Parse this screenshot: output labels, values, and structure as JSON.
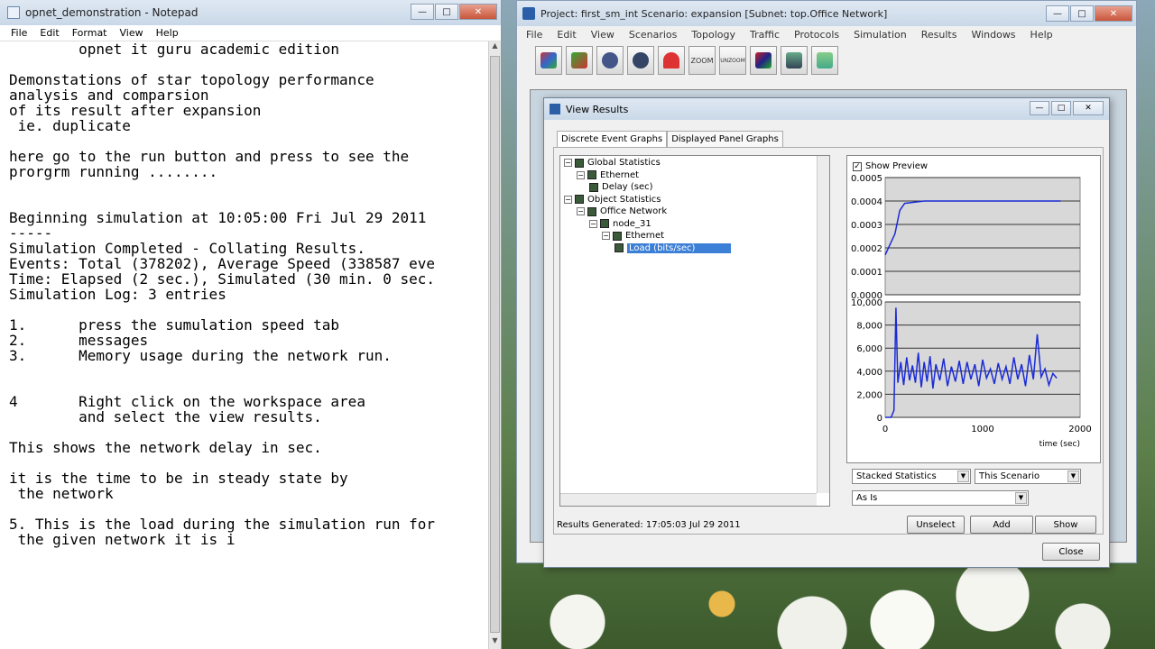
{
  "notepad": {
    "title": "opnet_demonstration - Notepad",
    "menu": [
      "File",
      "Edit",
      "Format",
      "View",
      "Help"
    ],
    "lines": [
      "        opnet it guru academic edition",
      "",
      "Demonstations of star topology performance",
      "analysis and comparsion",
      "of its result after expansion",
      " ie. duplicate",
      "",
      "here go to the run button and press to see the",
      "prorgrm running ........",
      "",
      "",
      "Beginning simulation at 10:05:00 Fri Jul 29 2011",
      "-----",
      "Simulation Completed - Collating Results.",
      "Events: Total (378202), Average Speed (338587 eve",
      "Time: Elapsed (2 sec.), Simulated (30 min. 0 sec.",
      "Simulation Log: 3 entries",
      "",
      "1.      press the sumulation speed tab",
      "2.      messages",
      "3.      Memory usage during the network run.",
      "",
      "",
      "4       Right click on the workspace area",
      "        and select the view results.",
      "",
      "This shows the network delay in sec.",
      "",
      "it is the time to be in steady state by",
      " the network",
      "",
      "5. This is the load during the simulation run for",
      " the given network it is i"
    ]
  },
  "project": {
    "title": "Project: first_sm_int Scenario: expansion  [Subnet: top.Office Network]",
    "menu": [
      "File",
      "Edit",
      "View",
      "Scenarios",
      "Topology",
      "Traffic",
      "Protocols",
      "Simulation",
      "Results",
      "Windows",
      "Help"
    ],
    "toolbar_labels": [
      "ZOOM",
      "UNZOOM"
    ]
  },
  "view_results": {
    "title": "View Results",
    "tabs": [
      "Discrete Event Graphs",
      "Displayed Panel Graphs"
    ],
    "tree": [
      {
        "label": "Global Statistics",
        "level": 0
      },
      {
        "label": "Ethernet",
        "level": 1
      },
      {
        "label": "Delay (sec)",
        "level": 2
      },
      {
        "label": "Object Statistics",
        "level": 0
      },
      {
        "label": "Office Network",
        "level": 1
      },
      {
        "label": "node_31",
        "level": 2
      },
      {
        "label": "Ethernet",
        "level": 3
      },
      {
        "label": "Load (bits/sec)",
        "level": 4,
        "selected": true
      }
    ],
    "show_preview_label": "Show Preview",
    "show_preview_checked": true,
    "stacked_select": "Stacked Statistics",
    "scenario_select": "This Scenario",
    "as_is_select": "As Is",
    "status": "Results Generated: 17:05:03 Jul 29 2011",
    "buttons": {
      "unselect": "Unselect",
      "add": "Add",
      "show": "Show",
      "close": "Close"
    }
  },
  "chart_data": [
    {
      "type": "line",
      "title": "",
      "ylim": [
        0,
        0.0005
      ],
      "yticks": [
        "0.0005",
        "0.0004",
        "0.0003",
        "0.0002",
        "0.0001",
        "0.0000"
      ],
      "xlim": [
        0,
        2000
      ],
      "series": [
        {
          "values": [
            [
              0,
              0.00017
            ],
            [
              100,
              0.00026
            ],
            [
              150,
              0.00036
            ],
            [
              200,
              0.00039
            ],
            [
              400,
              0.0004
            ],
            [
              800,
              0.0004
            ],
            [
              1200,
              0.0004
            ],
            [
              1800,
              0.0004
            ]
          ]
        }
      ]
    },
    {
      "type": "line",
      "ylim": [
        0,
        10000
      ],
      "yticks": [
        "10,000",
        "8,000",
        "6,000",
        "4,000",
        "2,000",
        "0"
      ],
      "xticks": [
        "0",
        "1000",
        "2000"
      ],
      "xlabel": "time (sec)",
      "xlim": [
        0,
        2000
      ],
      "series": [
        {
          "values": [
            [
              0,
              0
            ],
            [
              60,
              0
            ],
            [
              90,
              600
            ],
            [
              110,
              9500
            ],
            [
              130,
              3000
            ],
            [
              160,
              4800
            ],
            [
              190,
              2800
            ],
            [
              220,
              5200
            ],
            [
              250,
              3200
            ],
            [
              280,
              4500
            ],
            [
              310,
              3000
            ],
            [
              340,
              5600
            ],
            [
              370,
              2600
            ],
            [
              400,
              4800
            ],
            [
              430,
              3100
            ],
            [
              460,
              5300
            ],
            [
              490,
              2500
            ],
            [
              520,
              4600
            ],
            [
              560,
              3200
            ],
            [
              600,
              5100
            ],
            [
              640,
              2700
            ],
            [
              680,
              4400
            ],
            [
              720,
              3100
            ],
            [
              760,
              4900
            ],
            [
              800,
              2900
            ],
            [
              840,
              4800
            ],
            [
              880,
              3300
            ],
            [
              920,
              4600
            ],
            [
              960,
              2700
            ],
            [
              1000,
              5000
            ],
            [
              1040,
              3400
            ],
            [
              1080,
              4200
            ],
            [
              1120,
              2900
            ],
            [
              1160,
              4700
            ],
            [
              1200,
              3300
            ],
            [
              1240,
              4400
            ],
            [
              1280,
              2900
            ],
            [
              1320,
              5200
            ],
            [
              1360,
              3300
            ],
            [
              1400,
              4600
            ],
            [
              1440,
              2700
            ],
            [
              1480,
              5400
            ],
            [
              1520,
              3300
            ],
            [
              1560,
              7200
            ],
            [
              1600,
              3500
            ],
            [
              1640,
              4200
            ],
            [
              1680,
              2800
            ],
            [
              1720,
              3800
            ],
            [
              1760,
              3400
            ]
          ]
        }
      ]
    }
  ]
}
